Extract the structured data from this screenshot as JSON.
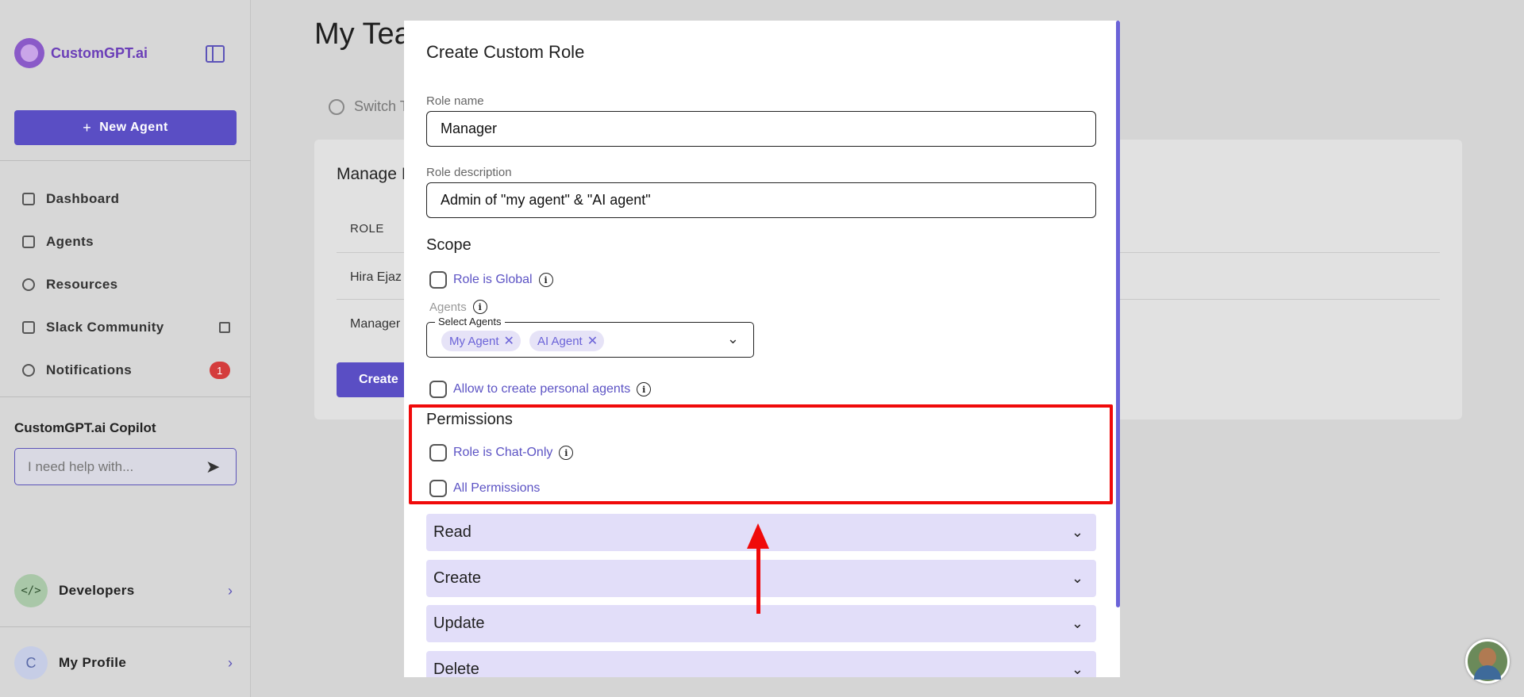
{
  "sidebar": {
    "logo_text": "CustomGPT.ai",
    "new_agent_label": "New Agent",
    "nav": [
      {
        "label": "Dashboard"
      },
      {
        "label": "Agents"
      },
      {
        "label": "Resources"
      },
      {
        "label": "Slack Community"
      },
      {
        "label": "Notifications",
        "badge": "1"
      }
    ],
    "copilot_title": "CustomGPT.ai Copilot",
    "copilot_placeholder": "I need help with...",
    "developers_label": "Developers",
    "developers_avatar": "</>",
    "profile_label": "My Profile",
    "profile_initial": "C"
  },
  "page": {
    "title": "My Tea",
    "switch_label": "Switch T",
    "card_title": "Manage I",
    "role_header": "ROLE",
    "rows": [
      "Hira Ejaz",
      "Manager"
    ],
    "create_label": "Create"
  },
  "modal": {
    "title": "Create Custom Role",
    "role_name_label": "Role name",
    "role_name_value": "Manager",
    "role_desc_label": "Role description",
    "role_desc_value": "Admin of \"my agent\" & \"AI agent\"",
    "scope_heading": "Scope",
    "role_global_label": "Role is Global",
    "agents_label": "Agents",
    "select_agents_legend": "Select Agents",
    "chips": [
      "My Agent",
      "AI Agent"
    ],
    "allow_personal_label": "Allow to create personal agents",
    "permissions_heading": "Permissions",
    "chat_only_label": "Role is Chat-Only",
    "all_permissions_label": "All Permissions",
    "accordions": [
      "Read",
      "Create",
      "Update",
      "Delete"
    ]
  },
  "colors": {
    "accent": "#5a4ec4",
    "highlight": "#f00a0a",
    "accordion_bg": "#e2def9"
  }
}
